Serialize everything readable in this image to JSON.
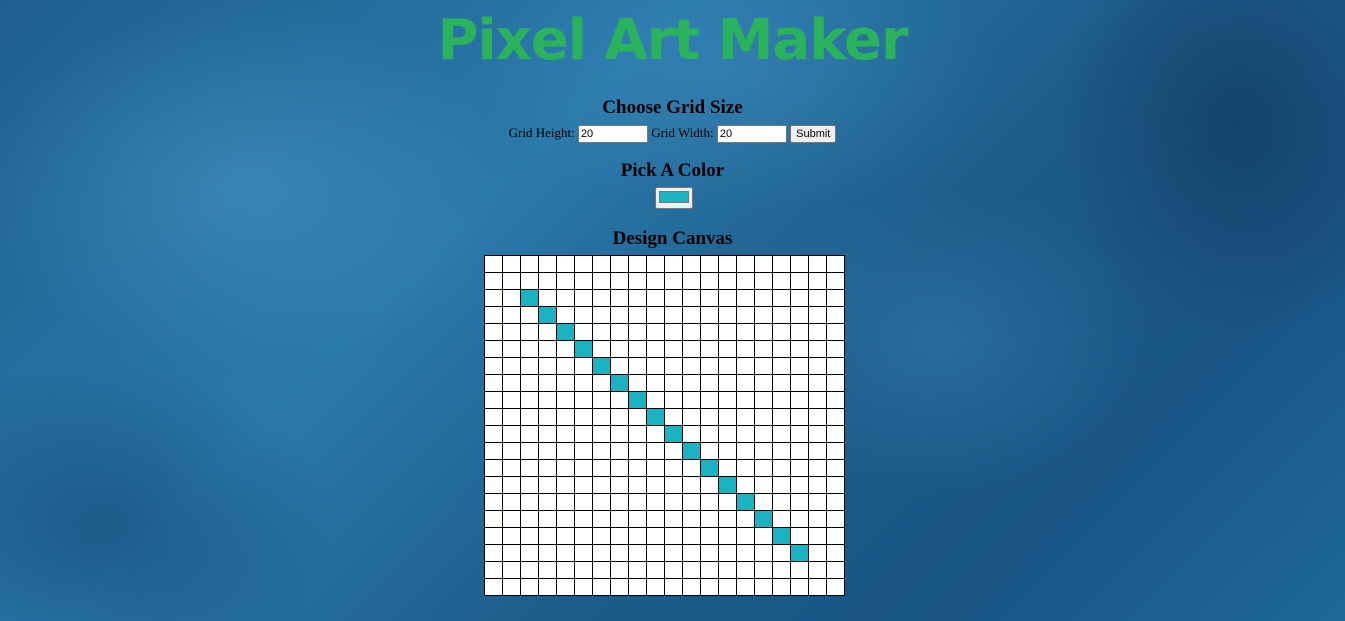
{
  "app": {
    "title": "Pixel Art Maker"
  },
  "grid_size": {
    "heading": "Choose Grid Size",
    "height_label": "Grid Height:",
    "height_value": "20",
    "width_label": "Grid Width:",
    "width_value": "20",
    "submit_label": "Submit"
  },
  "color": {
    "heading": "Pick A Color",
    "value": "#1ab3c1"
  },
  "canvas": {
    "heading": "Design Canvas",
    "rows": 20,
    "cols": 20,
    "background": "#ffffff",
    "filled_cells": [
      [
        2,
        2
      ],
      [
        3,
        3
      ],
      [
        4,
        4
      ],
      [
        5,
        5
      ],
      [
        6,
        6
      ],
      [
        7,
        7
      ],
      [
        8,
        8
      ],
      [
        9,
        9
      ],
      [
        10,
        10
      ],
      [
        11,
        11
      ],
      [
        12,
        12
      ],
      [
        13,
        13
      ],
      [
        14,
        14
      ],
      [
        15,
        15
      ],
      [
        16,
        16
      ],
      [
        17,
        17
      ]
    ]
  },
  "colors": {
    "logo": "#2ab35c",
    "fill": "#1ab3c1",
    "grid_line": "#000000",
    "background": "#1f5f8e"
  }
}
